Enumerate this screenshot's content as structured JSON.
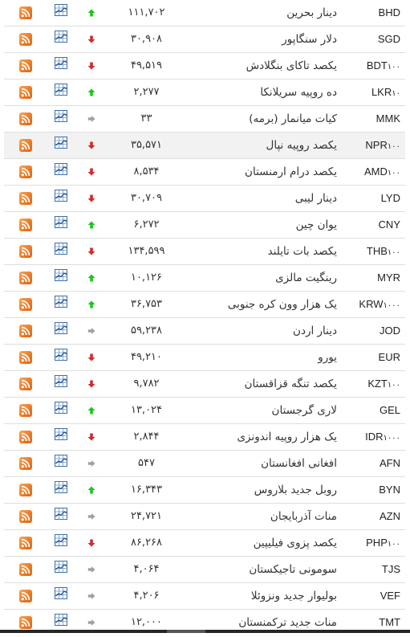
{
  "colors": {
    "up": "#1ec41e",
    "down": "#d22b2b",
    "same": "#a0a0a0",
    "rss": "#ee7a22",
    "chart_icon": "#3b6ea8",
    "hover_row": "#f2f2f2"
  },
  "hovered_row_index": 5,
  "rows": [
    {
      "code": "BHD",
      "unit": "",
      "name": "دینار بحرین",
      "value": "۱۱۱,۷۰۲",
      "trend": "up"
    },
    {
      "code": "SGD",
      "unit": "",
      "name": "دلار سنگاپور",
      "value": "۳۰,۹۰۸",
      "trend": "down"
    },
    {
      "code": "BDT",
      "unit": "۱۰۰",
      "name": "یکصد تاکای بنگلادش",
      "value": "۴۹,۵۱۹",
      "trend": "down"
    },
    {
      "code": "LKR",
      "unit": "۱۰",
      "name": "ده روپیه سریلانکا",
      "value": "۲,۲۷۷",
      "trend": "up"
    },
    {
      "code": "MMK",
      "unit": "",
      "name": "کیات میانمار (برمه)",
      "value": "۳۳",
      "trend": "same"
    },
    {
      "code": "NPR",
      "unit": "۱۰۰",
      "name": "یکصد روپیه نپال",
      "value": "۳۵,۵۷۱",
      "trend": "down"
    },
    {
      "code": "AMD",
      "unit": "۱۰۰",
      "name": "یکصد درام ارمنستان",
      "value": "۸,۵۳۴",
      "trend": "down"
    },
    {
      "code": "LYD",
      "unit": "",
      "name": "دینار لیبی",
      "value": "۳۰,۷۰۹",
      "trend": "down"
    },
    {
      "code": "CNY",
      "unit": "",
      "name": "یوان چین",
      "value": "۶,۲۷۲",
      "trend": "up"
    },
    {
      "code": "THB",
      "unit": "۱۰۰",
      "name": "یکصد بات تایلند",
      "value": "۱۳۴,۵۹۹",
      "trend": "down"
    },
    {
      "code": "MYR",
      "unit": "",
      "name": "رینگیت مالزی",
      "value": "۱۰,۱۲۶",
      "trend": "up"
    },
    {
      "code": "KRW",
      "unit": "۱۰۰۰",
      "name": "یک هزار وون کره جنوبی",
      "value": "۳۶,۷۵۳",
      "trend": "up"
    },
    {
      "code": "JOD",
      "unit": "",
      "name": "دینار اردن",
      "value": "۵۹,۲۳۸",
      "trend": "same"
    },
    {
      "code": "EUR",
      "unit": "",
      "name": "یورو",
      "value": "۴۹,۲۱۰",
      "trend": "down"
    },
    {
      "code": "KZT",
      "unit": "۱۰۰",
      "name": "یکصد تنگه قزاقستان",
      "value": "۹,۷۸۲",
      "trend": "down"
    },
    {
      "code": "GEL",
      "unit": "",
      "name": "لاری گرجستان",
      "value": "۱۳,۰۲۴",
      "trend": "up"
    },
    {
      "code": "IDR",
      "unit": "۱۰۰۰",
      "name": "یک هزار روپیه اندونزی",
      "value": "۲,۸۴۴",
      "trend": "down"
    },
    {
      "code": "AFN",
      "unit": "",
      "name": "افغانی افغانستان",
      "value": "۵۴۷",
      "trend": "same"
    },
    {
      "code": "BYN",
      "unit": "",
      "name": "روبل جدید بلاروس",
      "value": "۱۶,۳۴۳",
      "trend": "up"
    },
    {
      "code": "AZN",
      "unit": "",
      "name": "منات آذربایجان",
      "value": "۲۴,۷۲۱",
      "trend": "same"
    },
    {
      "code": "PHP",
      "unit": "۱۰۰",
      "name": "یکصد پزوی فیلیپین",
      "value": "۸۶,۲۶۸",
      "trend": "down"
    },
    {
      "code": "TJS",
      "unit": "",
      "name": "سومونی تاجیکستان",
      "value": "۴,۰۶۴",
      "trend": "same"
    },
    {
      "code": "VEF",
      "unit": "",
      "name": "بولیوار جدید ونزوئلا",
      "value": "۴,۲۰۶",
      "trend": "same"
    },
    {
      "code": "TMT",
      "unit": "",
      "name": "منات جدید ترکمنستان",
      "value": "۱۲,۰۰۰",
      "trend": "same"
    }
  ],
  "icons": {
    "rss": "rss-feed-icon",
    "chart": "line-chart-icon",
    "up": "arrow-up-icon",
    "down": "arrow-down-icon",
    "same": "arrow-right-icon"
  }
}
